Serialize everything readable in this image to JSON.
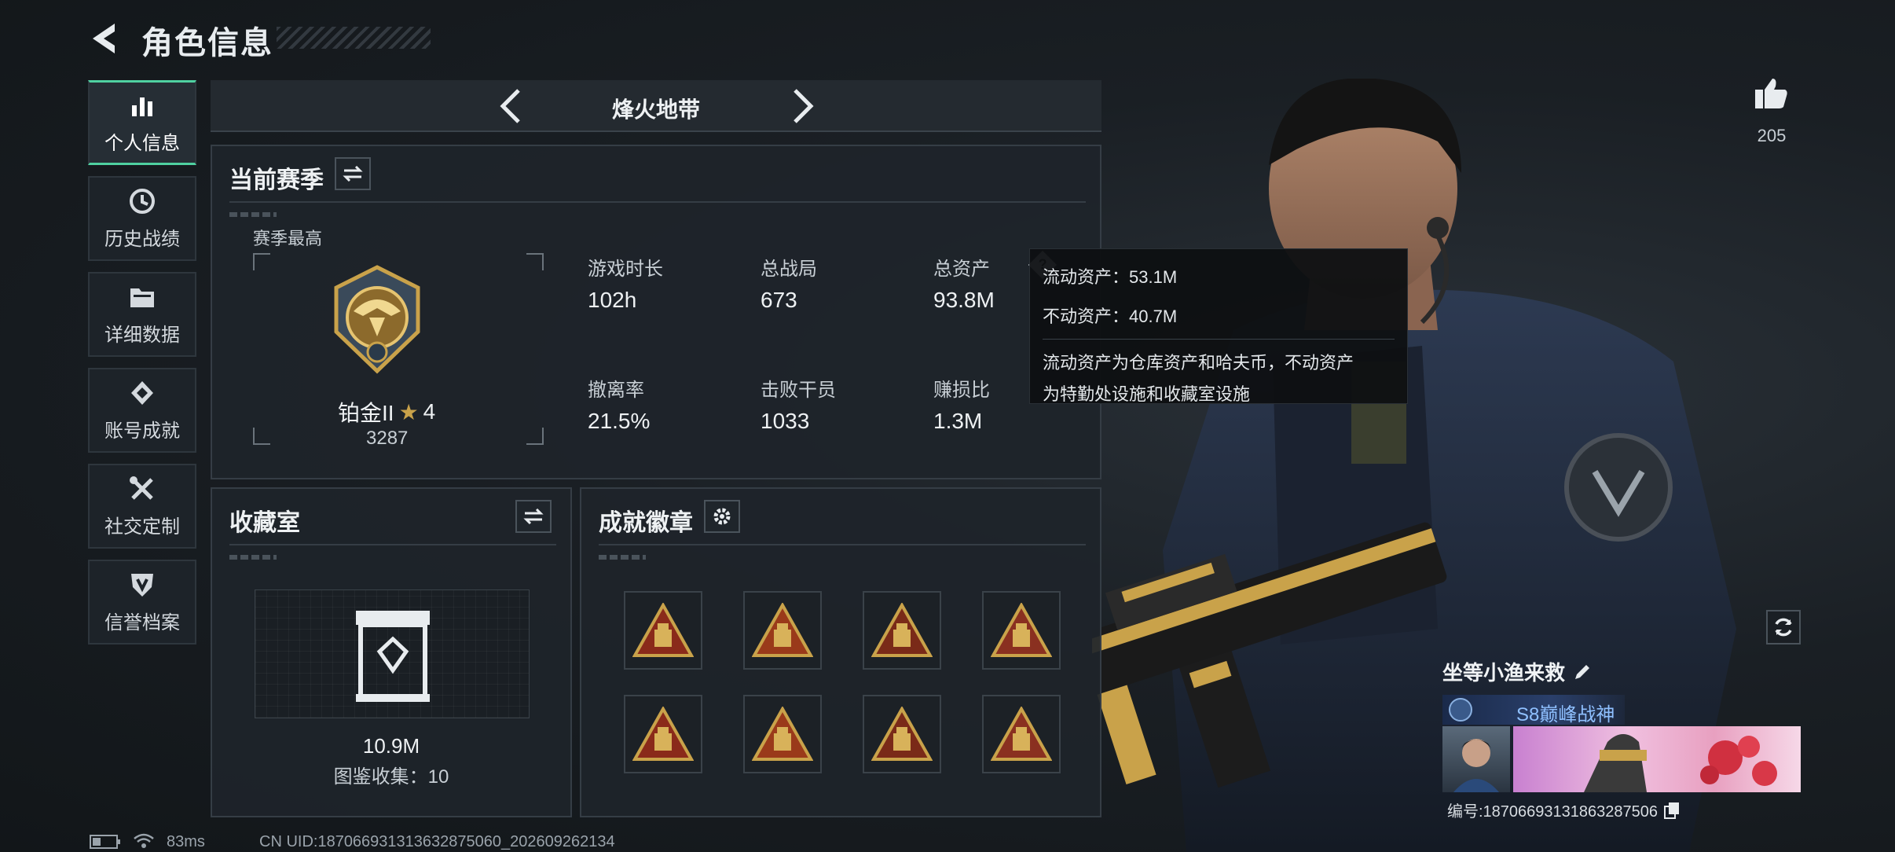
{
  "header": {
    "title": "角色信息"
  },
  "nav": [
    {
      "id": "personal",
      "label": "个人信息",
      "icon": "bar-chart-icon",
      "active": true
    },
    {
      "id": "history",
      "label": "历史战绩",
      "icon": "history-icon",
      "active": false
    },
    {
      "id": "detail",
      "label": "详细数据",
      "icon": "folder-icon",
      "active": false
    },
    {
      "id": "achieve",
      "label": "账号成就",
      "icon": "achievement-icon",
      "active": false
    },
    {
      "id": "social",
      "label": "社交定制",
      "icon": "tools-icon",
      "active": false
    },
    {
      "id": "credit",
      "label": "信誉档案",
      "icon": "shield-icon",
      "active": false
    }
  ],
  "map_selector": {
    "name": "烽火地带"
  },
  "season_panel": {
    "title": "当前赛季",
    "best_label": "赛季最高",
    "rank_name": "铂金II",
    "rank_star": "★",
    "rank_stars": "4",
    "rank_score": "3287",
    "stats": [
      {
        "label": "游戏时长",
        "value": "102h"
      },
      {
        "label": "总战局",
        "value": "673"
      },
      {
        "label": "总资产",
        "value": "93.8M"
      },
      {
        "label": "撤离率",
        "value": "21.5%"
      },
      {
        "label": "击败干员",
        "value": "1033"
      },
      {
        "label": "赚损比",
        "value": "1.3M"
      }
    ],
    "help_glyph": "?"
  },
  "tooltip": {
    "line1": "流动资产：53.1M",
    "line2": "不动资产：40.7M",
    "desc1": "流动资产为仓库资产和哈夫币，不动资产",
    "desc2": "为特勤处设施和收藏室设施"
  },
  "collection_panel": {
    "title": "收藏室",
    "value": "10.9M",
    "catalog": "图鉴收集：10"
  },
  "badge_panel": {
    "title": "成就徽章",
    "badges": [
      "badge-1",
      "badge-2",
      "badge-3",
      "badge-4",
      "badge-5",
      "badge-6",
      "badge-7",
      "badge-8"
    ]
  },
  "profile": {
    "likes": "205",
    "name": "坐等小渔来救",
    "title": "S8巅峰战神",
    "id_line": "编号:18706693131863287506"
  },
  "status_bar": {
    "ping": "83ms",
    "uid": "CN UID:187066931313632875060_202609262134"
  },
  "colors": {
    "accent": "#4fd1a1",
    "bg": "#1a1f24",
    "panel": "#1e242a",
    "gold": "#c9a24a"
  }
}
